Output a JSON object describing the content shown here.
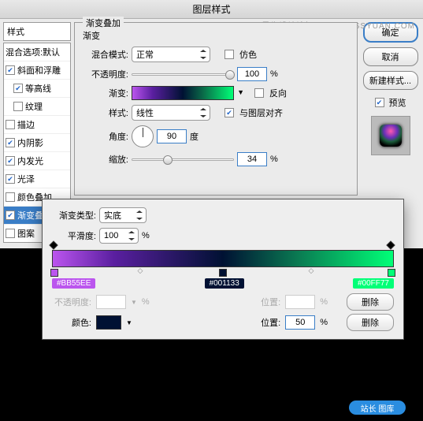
{
  "title": "图层样式",
  "watermark": "思缘设计论坛  WWW.MISSYUAN.COM",
  "sidebar": {
    "heading": "样式",
    "section": "混合选项:默认",
    "items": [
      {
        "label": "斜面和浮雕",
        "checked": true,
        "selected": false
      },
      {
        "label": "等高线",
        "checked": true,
        "selected": false
      },
      {
        "label": "纹理",
        "checked": false,
        "selected": false
      },
      {
        "label": "描边",
        "checked": false,
        "selected": false
      },
      {
        "label": "内阴影",
        "checked": true,
        "selected": false
      },
      {
        "label": "内发光",
        "checked": true,
        "selected": false
      },
      {
        "label": "光泽",
        "checked": true,
        "selected": false
      },
      {
        "label": "颜色叠加",
        "checked": false,
        "selected": false
      },
      {
        "label": "渐变叠",
        "checked": true,
        "selected": true
      },
      {
        "label": "图案",
        "checked": false,
        "selected": false
      }
    ]
  },
  "panel": {
    "title": "渐变叠加",
    "section": "渐变",
    "blend_label": "混合模式:",
    "blend_value": "正常",
    "dither_label": "仿色",
    "opacity_label": "不透明度:",
    "opacity_value": "100",
    "pct": "%",
    "gradient_label": "渐变:",
    "reverse_label": "反向",
    "style_label": "样式:",
    "style_value": "线性",
    "align_label": "与图层对齐",
    "angle_label": "角度:",
    "angle_value": "90",
    "degree": "度",
    "scale_label": "缩放:",
    "scale_value": "34"
  },
  "buttons": {
    "ok": "确定",
    "cancel": "取消",
    "newstyle": "新建样式...",
    "preview": "预览"
  },
  "editor": {
    "type_label": "渐变类型:",
    "type_value": "实底",
    "smooth_label": "平滑度:",
    "smooth_value": "100",
    "pct": "%",
    "colors": [
      {
        "hex": "#BB55EE",
        "pos": 0
      },
      {
        "hex": "#001133",
        "pos": 50
      },
      {
        "hex": "#00FF77",
        "pos": 100
      }
    ],
    "o_label": "不透明度:",
    "pos_label": "位置:",
    "color_label": "颜色:",
    "pos_value": "50",
    "delete": "删除"
  },
  "badge": "站长 图库"
}
